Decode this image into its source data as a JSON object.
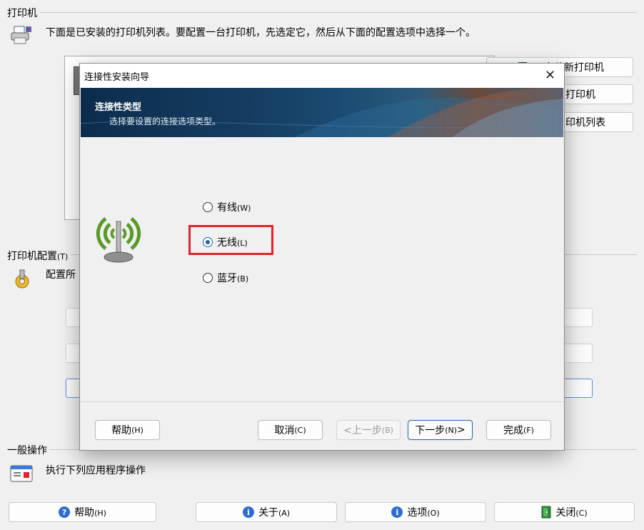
{
  "printers_section": {
    "title": "打印机",
    "description": "下面是已安装的打印机列表。要配置一台打印机，先选定它，然后从下面的配置选项中选择一个。",
    "side_buttons": [
      "安装新打印机",
      "打印机",
      "印机列表"
    ]
  },
  "config_section": {
    "title": "打印机配置",
    "title_key": "(T)",
    "description": "配置所"
  },
  "general_section": {
    "title": "一般操作",
    "description": "执行下列应用程序操作",
    "buttons": [
      {
        "label": "帮助",
        "key": "(H)",
        "icon": "help-icon"
      },
      {
        "label": "关于",
        "key": "(A)",
        "icon": "info-icon"
      },
      {
        "label": "选项",
        "key": "(O)",
        "icon": "info-icon"
      },
      {
        "label": "关闭",
        "key": "(C)",
        "icon": "door-exit-icon"
      }
    ]
  },
  "dialog": {
    "title": "连接性安装向导",
    "close_glyph": "✕",
    "banner_title": "连接性类型",
    "banner_subtitle": "选择要设置的连接选项类型。",
    "options": [
      {
        "label": "有线",
        "key": "(W)",
        "checked": false
      },
      {
        "label": "无线",
        "key": "(L)",
        "checked": true
      },
      {
        "label": "蓝牙",
        "key": "(B)",
        "checked": false
      }
    ],
    "buttons": {
      "help": {
        "label": "帮助",
        "key": "(H)"
      },
      "cancel": {
        "label": "取消",
        "key": "(C)"
      },
      "back": {
        "label": "<上一步",
        "key": "(B)"
      },
      "next": {
        "label": "下一步",
        "key": "(N)",
        "suffix": ">"
      },
      "finish": {
        "label": "完成",
        "key": "(F)"
      }
    }
  },
  "colors": {
    "highlight_border": "#e3242b",
    "wireless_icon_green": "#5a9a2a",
    "radio_checked": "#1a5fb4"
  }
}
